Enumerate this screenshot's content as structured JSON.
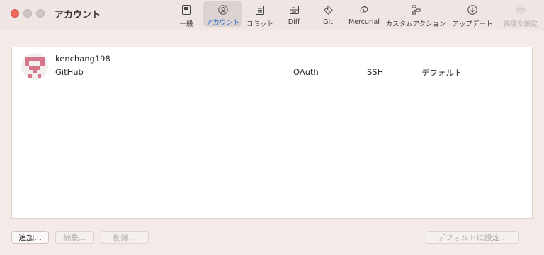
{
  "window": {
    "title": "アカウント"
  },
  "toolbar": {
    "items": [
      {
        "label": "一般",
        "icon": "general-icon"
      },
      {
        "label": "アカウント",
        "icon": "account-icon",
        "selected": true
      },
      {
        "label": "コミット",
        "icon": "commit-icon"
      },
      {
        "label": "Diff",
        "icon": "diff-icon"
      },
      {
        "label": "Git",
        "icon": "git-icon"
      },
      {
        "label": "Mercurial",
        "icon": "mercurial-icon"
      },
      {
        "label": "カスタムアクション",
        "icon": "custom-actions-icon"
      },
      {
        "label": "アップデート",
        "icon": "update-icon"
      },
      {
        "label": "高度な設定",
        "icon": "advanced-gear-icon",
        "disabled": true
      }
    ]
  },
  "accounts": [
    {
      "username": "kenchang198",
      "service": "GitHub",
      "auth": "OAuth",
      "protocol": "SSH",
      "default_label": "デフォルト"
    }
  ],
  "buttons": {
    "add": "追加...",
    "edit": "編集...",
    "delete": "削除...",
    "set_default": "デフォルトに設定..."
  },
  "colors": {
    "accent": "#2f6fd0",
    "avatar": "#d5768a",
    "close": "#ed6a5e"
  }
}
